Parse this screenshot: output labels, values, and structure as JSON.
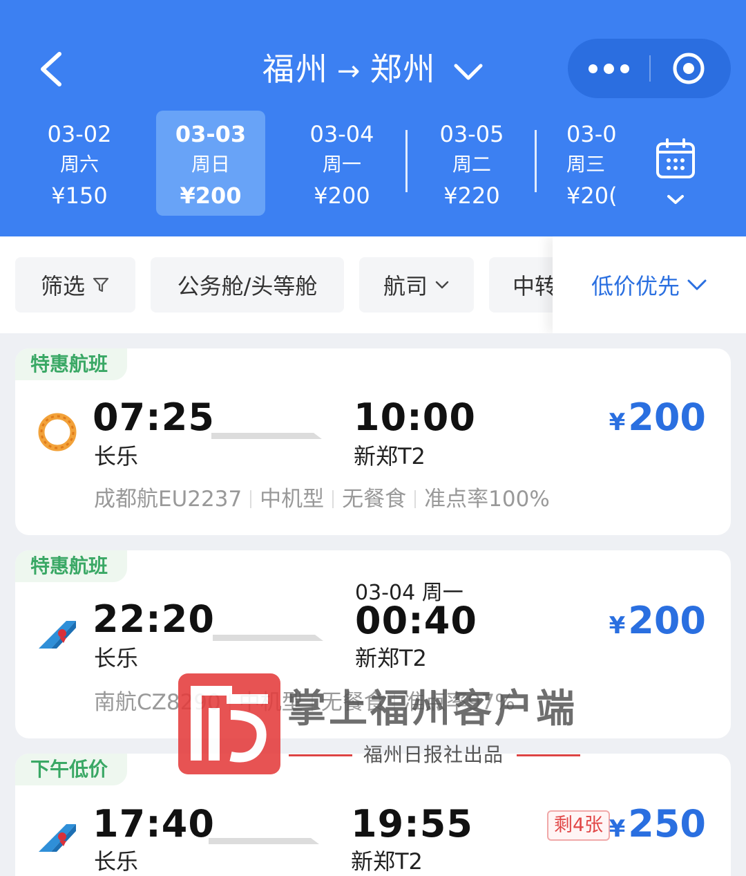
{
  "header": {
    "origin": "福州",
    "arrow": "→",
    "destination": "郑州",
    "dates": [
      {
        "date": "03-02",
        "weekday": "周六",
        "price": "¥150"
      },
      {
        "date": "03-03",
        "weekday": "周日",
        "price": "¥200",
        "active": true
      },
      {
        "date": "03-04",
        "weekday": "周一",
        "price": "¥200"
      },
      {
        "date": "03-05",
        "weekday": "周二",
        "price": "¥220"
      },
      {
        "date": "03-0",
        "weekday": "周三",
        "price": "¥20("
      }
    ]
  },
  "filters": {
    "filter_label": "筛选",
    "cabin_label": "公务舱/头等舱",
    "airline_label": "航司",
    "transfer_label": "中转",
    "sort_label": "低价优先"
  },
  "flights": [
    {
      "tag": "特惠航班",
      "logo": "sichuan-chengdu-airline-logo",
      "dep_time": "07:25",
      "dep_airport": "长乐",
      "arr_time": "10:00",
      "arr_airport": "新郑T2",
      "next_day": "",
      "currency": "¥",
      "price": "200",
      "flight_no": "成都航EU2237",
      "aircraft": "中机型",
      "meal": "无餐食",
      "ontime": "准点率100%"
    },
    {
      "tag": "特惠航班",
      "logo": "china-southern-logo",
      "dep_time": "22:20",
      "dep_airport": "长乐",
      "arr_time": "00:40",
      "arr_airport": "新郑T2",
      "next_day": "03-04 周一",
      "currency": "¥",
      "price": "200",
      "flight_no": "南航CZ8290",
      "aircraft": "中机型",
      "meal": "无餐食",
      "ontime": "准点率97%"
    },
    {
      "tag": "下午低价",
      "logo": "china-southern-logo",
      "dep_time": "17:40",
      "dep_airport": "长乐",
      "arr_time": "19:55",
      "arr_airport": "新郑T2",
      "badge": "剩4张",
      "currency": "¥",
      "price": "250"
    }
  ],
  "watermark": {
    "title": "掌上福州客户端",
    "subtitle": "福州日报社出品"
  },
  "colors": {
    "header_bg": "#3c80f2",
    "accent": "#2a6fe0",
    "tag_green": "#3aa865",
    "badge_red": "#e14747"
  }
}
